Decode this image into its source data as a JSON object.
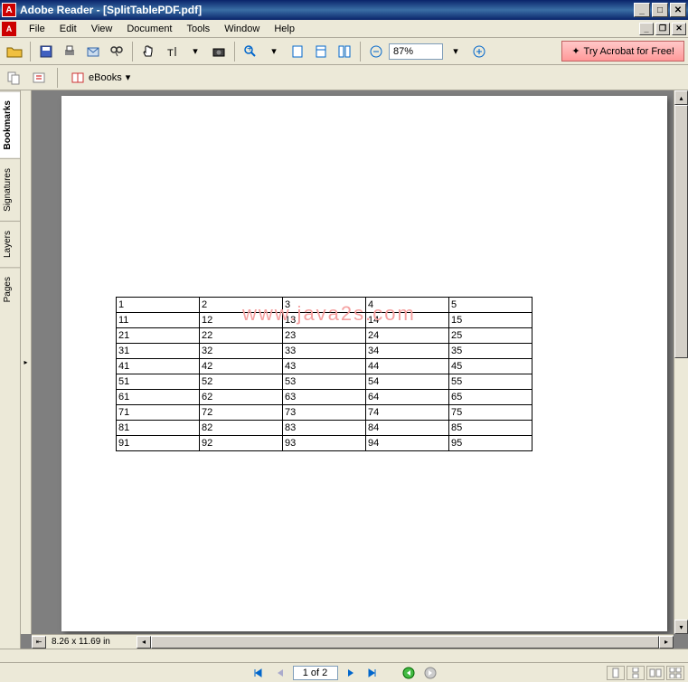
{
  "window": {
    "title": "Adobe Reader - [SplitTablePDF.pdf]"
  },
  "menu": {
    "items": [
      "File",
      "Edit",
      "View",
      "Document",
      "Tools",
      "Window",
      "Help"
    ]
  },
  "toolbar": {
    "zoom": "87%",
    "acrobat_label": "Try Acrobat for Free!",
    "ebooks_label": "eBooks"
  },
  "sidebar": {
    "tabs": [
      "Bookmarks",
      "Signatures",
      "Layers",
      "Pages"
    ],
    "active": 0
  },
  "status": {
    "page_size": "8.26 x 11.69 in",
    "page_display": "1 of 2"
  },
  "watermark": "www.java2s.com",
  "chart_data": {
    "type": "table",
    "rows": [
      [
        "1",
        "2",
        "3",
        "4",
        "5"
      ],
      [
        "11",
        "12",
        "13",
        "14",
        "15"
      ],
      [
        "21",
        "22",
        "23",
        "24",
        "25"
      ],
      [
        "31",
        "32",
        "33",
        "34",
        "35"
      ],
      [
        "41",
        "42",
        "43",
        "44",
        "45"
      ],
      [
        "51",
        "52",
        "53",
        "54",
        "55"
      ],
      [
        "61",
        "62",
        "63",
        "64",
        "65"
      ],
      [
        "71",
        "72",
        "73",
        "74",
        "75"
      ],
      [
        "81",
        "82",
        "83",
        "84",
        "85"
      ],
      [
        "91",
        "92",
        "93",
        "94",
        "95"
      ]
    ]
  }
}
